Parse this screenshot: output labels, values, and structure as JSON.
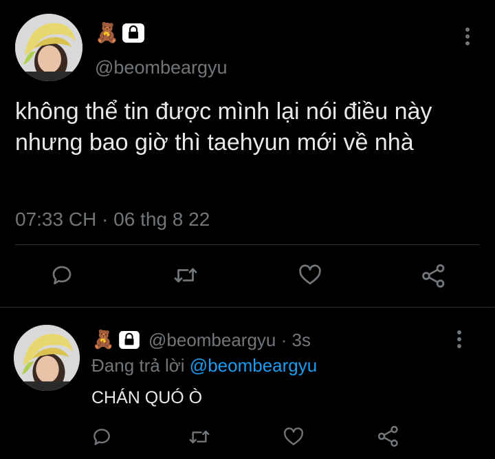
{
  "main_tweet": {
    "emoji_bear": "🧸",
    "handle": "@beombeargyu",
    "text": "không thể tin được mình lại nói điều này nhưng bao giờ thì taehyun mới về nhà",
    "timestamp": "07:33 CH · 06 thg 8 22",
    "actions": [
      "reply-icon",
      "retweet-icon",
      "like-icon",
      "share-icon"
    ]
  },
  "reply_tweet": {
    "emoji_bear": "🧸",
    "handle": "@beombeargyu",
    "time_sep": "·",
    "age": "3s",
    "replying_prefix": "Đang trả lời",
    "replying_to": "@beombeargyu",
    "text": "CHÁN QUÓ Ò",
    "actions": [
      "reply-icon",
      "retweet-icon",
      "like-icon",
      "share-icon"
    ]
  },
  "colors": {
    "background": "#000000",
    "text": "#e7e9ea",
    "muted": "#71767b",
    "link": "#1d9bf0",
    "divider": "#2f3336"
  }
}
